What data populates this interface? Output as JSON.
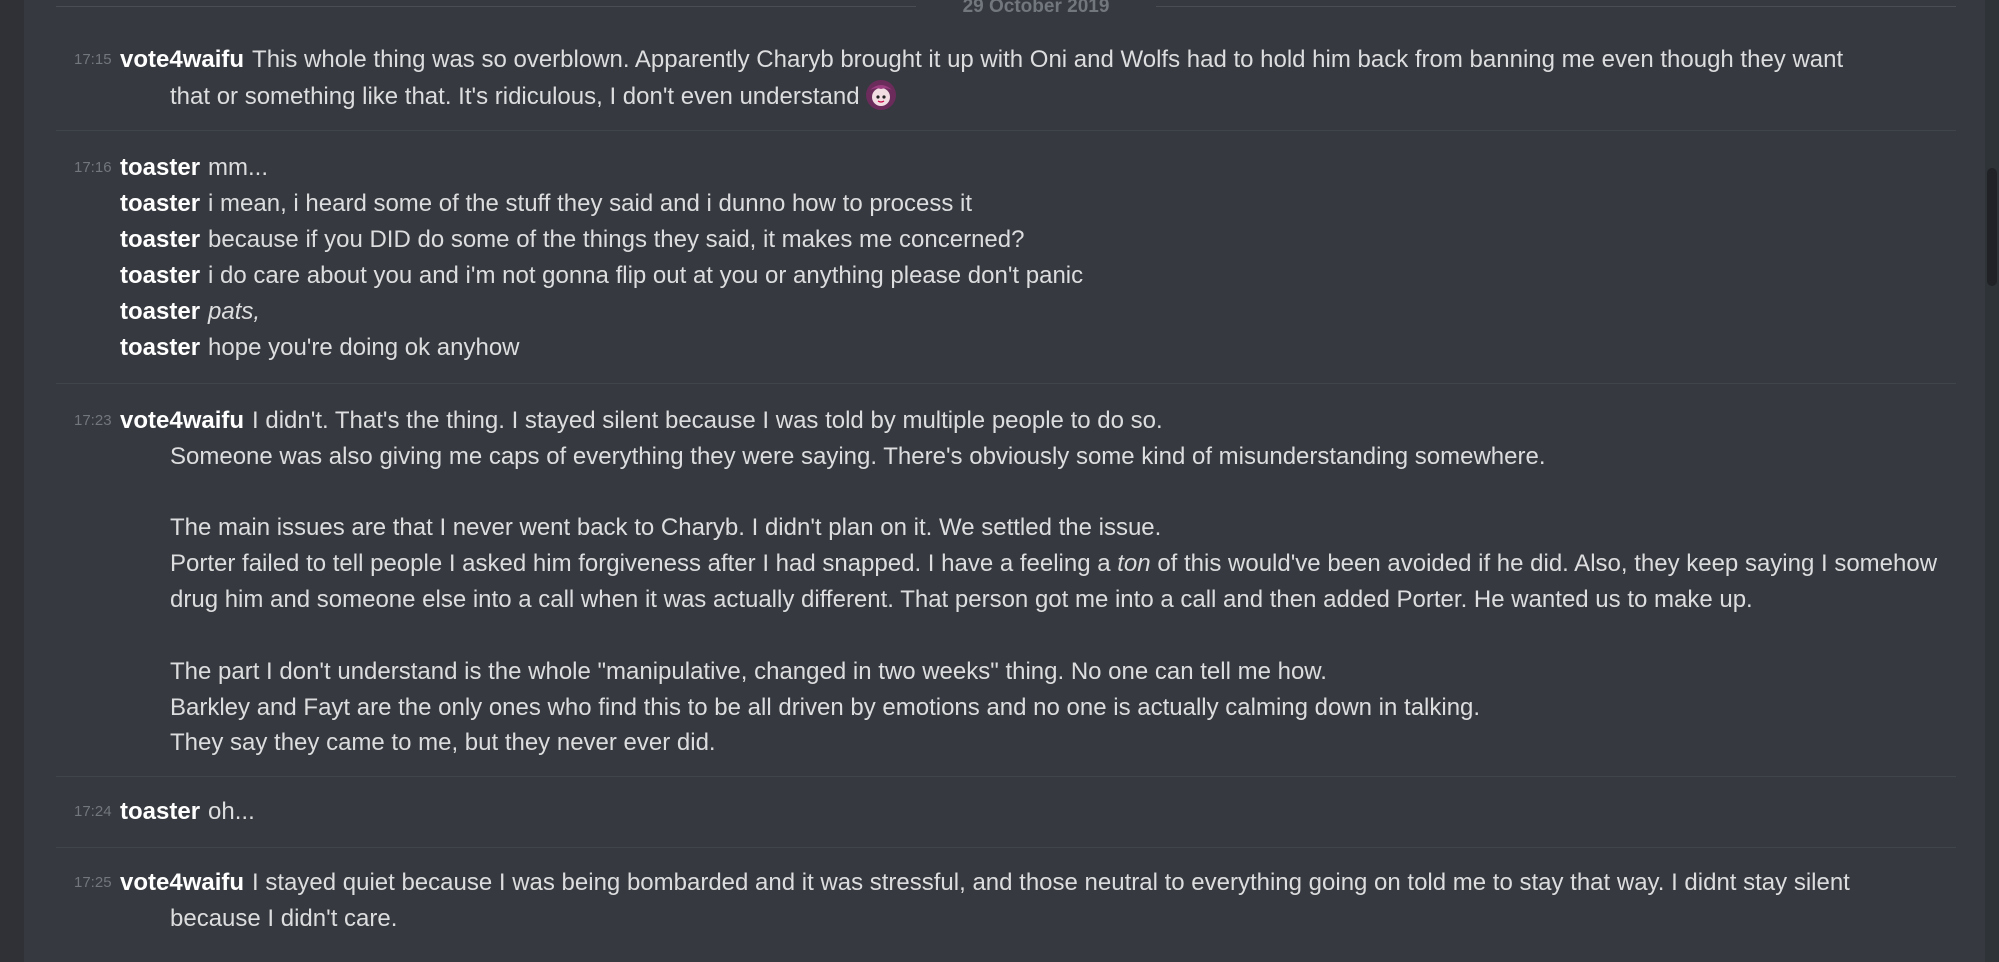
{
  "date": "29 October 2019",
  "groups": [
    {
      "time": "17:15",
      "author": "vote4waifu",
      "lines": [
        "This whole thing was so overblown. Apparently Charyb brought it up with Oni and Wolfs had to hold him back from banning me even though they want",
        "that or something like that. It's ridiculous, I don't even understand"
      ],
      "emoji": "anime-girl-emoji"
    },
    {
      "time": "17:16",
      "messages": [
        {
          "author": "toaster",
          "text": "mm..."
        },
        {
          "author": "toaster",
          "text": "i mean, i heard some of the stuff they said and i dunno how to process it"
        },
        {
          "author": "toaster",
          "text": "because if you DID do some of the things they said, it makes me concerned?"
        },
        {
          "author": "toaster",
          "text": "i do care about you and i'm not gonna flip out at you or anything please don't panic"
        },
        {
          "author": "toaster",
          "text": "pats,"
        },
        {
          "author": "toaster",
          "text": "hope you're doing ok anyhow"
        }
      ]
    },
    {
      "time": "17:23",
      "author": "vote4waifu",
      "lines": [
        "I didn't. That's the thing. I stayed silent because I was told by multiple people to do so.",
        "Someone was also giving me caps of everything they were saying. There's obviously some kind of misunderstanding somewhere.",
        "The main issues are that I never went back to Charyb. I didn't plan on it. We settled the issue.",
        "Porter failed to tell people I asked him forgiveness after I had snapped. I have a feeling a",
        "ton",
        "of this would've been avoided if he did. Also, they keep saying I somehow",
        "drug him and someone else into a call when it was actually different. That person got me into a call and then added Porter. He wanted us to make up.",
        "The part I don't understand is the whole \"manipulative, changed in two weeks\" thing. No one can tell me how.",
        "Barkley and Fayt are the only ones who find this to be all driven by emotions and no one is actually calming down in talking.",
        "They say they came to me, but they never ever did."
      ]
    },
    {
      "time": "17:24",
      "author": "toaster",
      "text": "oh..."
    },
    {
      "time": "17:25",
      "author": "vote4waifu",
      "lines": [
        "I stayed quiet because I was being bombarded and it was stressful, and those neutral to everything going on told me to stay that way. I didnt stay silent",
        "because I didn't care."
      ]
    }
  ]
}
